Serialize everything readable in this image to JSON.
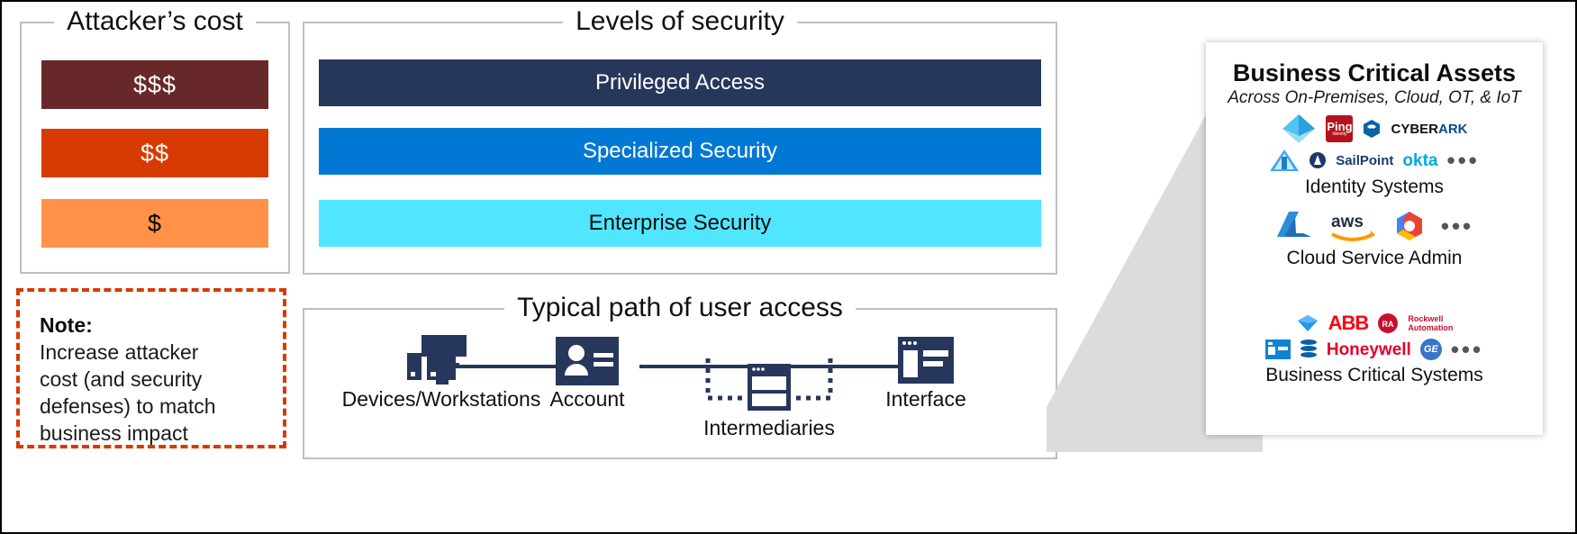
{
  "attacker": {
    "title": "Attacker’s cost",
    "bars": [
      {
        "label": "$$$",
        "color": "#68282A"
      },
      {
        "label": "$$",
        "color": "#D73A02"
      },
      {
        "label": "$",
        "color": "#FF9248"
      }
    ]
  },
  "note": {
    "title": "Note:",
    "lines": [
      "Increase attacker",
      "cost (and security",
      "defenses) to match",
      "business impact"
    ],
    "border_color": "#D73A02"
  },
  "levels": {
    "title": "Levels of security",
    "bars": [
      {
        "label": "Privileged Access",
        "color": "#27375C",
        "text_color": "#ffffff"
      },
      {
        "label": "Specialized Security",
        "color": "#0078D4",
        "text_color": "#ffffff"
      },
      {
        "label": "Enterprise Security",
        "color": "#50E6FF",
        "text_color": "#0a0a0a"
      }
    ]
  },
  "path": {
    "title": "Typical path of user access",
    "nodes": [
      {
        "label": "Devices/Workstations",
        "icon": "workstation-icon"
      },
      {
        "label": "Account",
        "icon": "account-card-icon"
      },
      {
        "label": "Intermediaries",
        "icon": "intermediaries-icon"
      },
      {
        "label": "Interface",
        "icon": "interface-window-icon"
      }
    ],
    "accent_color": "#27375C"
  },
  "assets": {
    "title": "Business Critical Assets",
    "subtitle": "Across On-Premises, Cloud, OT, & IoT",
    "categories": [
      {
        "label": "Identity Systems",
        "logos": [
          "azure-ad-icon",
          "ping-identity-logo",
          "cyberark-logo",
          "thycotic-icon",
          "sailpoint-logo",
          "okta-logo"
        ],
        "more": "•••"
      },
      {
        "label": "Cloud Service Admin",
        "logos": [
          "azure-logo",
          "aws-logo",
          "google-cloud-logo"
        ],
        "more": "•••"
      },
      {
        "label": "Business Critical Systems",
        "logos": [
          "sap-icon",
          "siemens-icon",
          "abb-logo",
          "rockwell-automation-logo",
          "osisoft-icon",
          "honeywell-logo",
          "ge-logo"
        ],
        "more": "•••"
      }
    ]
  },
  "logo_text": {
    "ping": "Ping",
    "ping_sub": "Identity",
    "cyberark_a": "CYBER",
    "cyberark_b": "ARK",
    "sailpoint": "SailPoint",
    "okta": "okta",
    "aws": "aws",
    "abb": "ABB",
    "rockwell_1": "Rockwell",
    "rockwell_2": "Automation",
    "honeywell": "Honeywell",
    "ge": "GE"
  },
  "colors": {
    "frame": "#bfbfbf",
    "funnel": "#DCDCDC",
    "dark_navy": "#27375C",
    "accent_orange": "#D73A02"
  }
}
